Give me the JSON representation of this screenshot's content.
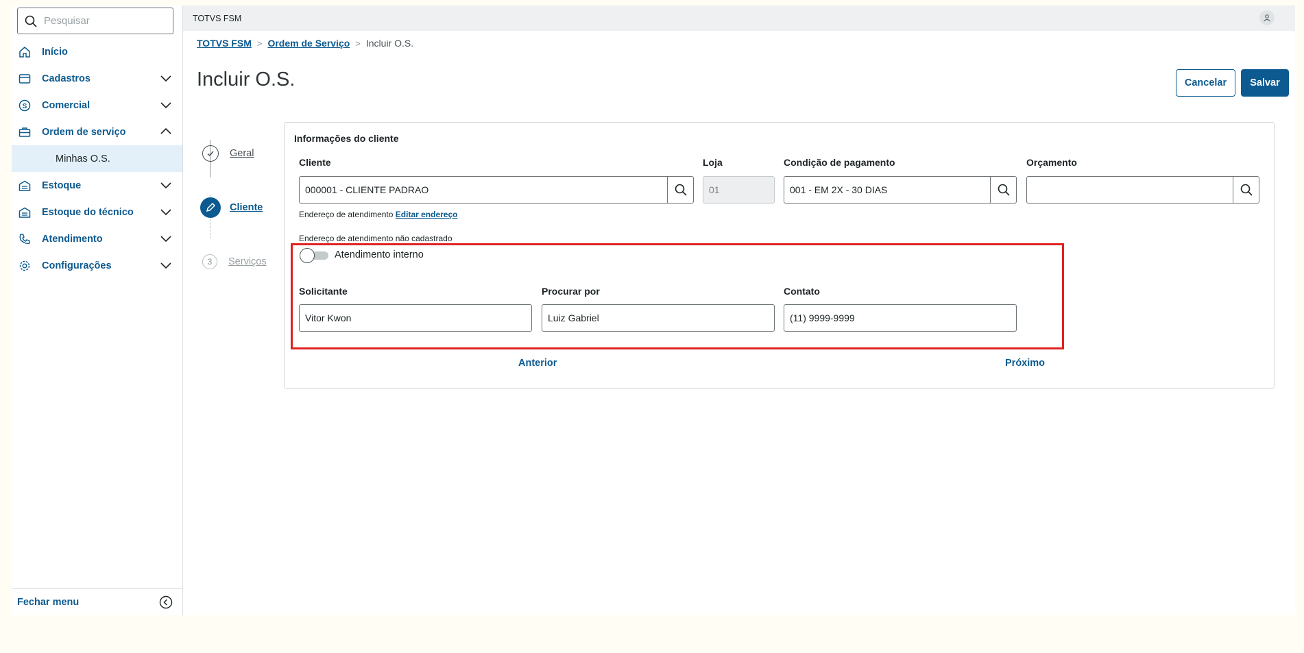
{
  "sidebar": {
    "search_placeholder": "Pesquisar",
    "items": [
      {
        "label": "Início",
        "icon": "home-icon"
      },
      {
        "label": "Cadastros",
        "icon": "card-icon"
      },
      {
        "label": "Comercial",
        "icon": "dollar-icon"
      },
      {
        "label": "Ordem de serviço",
        "icon": "briefcase-icon"
      },
      {
        "label": "Estoque",
        "icon": "warehouse-icon"
      },
      {
        "label": "Estoque do técnico",
        "icon": "warehouse-icon"
      },
      {
        "label": "Atendimento",
        "icon": "phone-icon"
      },
      {
        "label": "Configurações",
        "icon": "gear-icon"
      }
    ],
    "submenu": {
      "label": "Minhas O.S."
    },
    "footer_label": "Fechar menu"
  },
  "topbar": {
    "app_name": "TOTVS FSM"
  },
  "breadcrumb": {
    "items": [
      "TOTVS FSM",
      "Ordem de Serviço"
    ],
    "current": "Incluir O.S."
  },
  "page": {
    "title": "Incluir O.S.",
    "cancel_label": "Cancelar",
    "save_label": "Salvar"
  },
  "stepper": {
    "steps": [
      {
        "label": "Geral",
        "state": "done"
      },
      {
        "label": "Cliente",
        "state": "active"
      },
      {
        "label": "Serviços",
        "state": "pending",
        "number": "3"
      }
    ]
  },
  "form": {
    "section_title": "Informações do cliente",
    "cliente": {
      "label": "Cliente",
      "value": "000001 - CLIENTE PADRAO"
    },
    "loja": {
      "label": "Loja",
      "value": "01"
    },
    "condicao": {
      "label": "Condição de pagamento",
      "value": "001 - EM 2X - 30 DIAS"
    },
    "orcamento": {
      "label": "Orçamento",
      "value": ""
    },
    "endereco_label": "Endereço de atendimento",
    "editar_endereco": "Editar endereço",
    "endereco_status": "Endereço de atendimento não cadastrado",
    "toggle_label": "Atendimento interno",
    "toggle_on": false,
    "solicitante": {
      "label": "Solicitante",
      "value": "Vitor Kwon"
    },
    "procurar": {
      "label": "Procurar por",
      "value": "Luiz Gabriel"
    },
    "contato": {
      "label": "Contato",
      "value": "(11) 9999-9999"
    },
    "anterior": "Anterior",
    "proximo": "Próximo"
  },
  "colors": {
    "primary": "#0c5a8f",
    "highlight": "#e02020"
  }
}
